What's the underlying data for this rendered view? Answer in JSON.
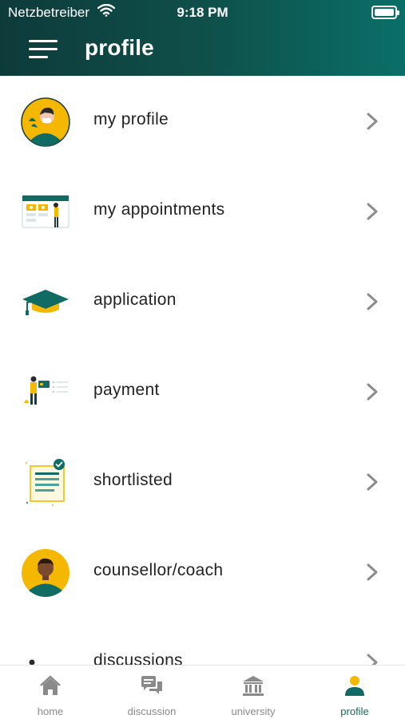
{
  "status_bar": {
    "carrier": "Netzbetreiber",
    "time": "9:18 PM"
  },
  "header": {
    "title": "profile",
    "menu_icon": "hamburger-menu-icon"
  },
  "menu_items": [
    {
      "label": "my profile",
      "icon": "user-avatar-icon"
    },
    {
      "label": "my appointments",
      "icon": "calendar-icon"
    },
    {
      "label": "application",
      "icon": "graduation-cap-icon"
    },
    {
      "label": "payment",
      "icon": "payment-card-icon"
    },
    {
      "label": "shortlisted",
      "icon": "checklist-document-icon"
    },
    {
      "label": "counsellor/coach",
      "icon": "counsellor-avatar-icon"
    },
    {
      "label": "discussions",
      "icon": "discussion-board-icon"
    }
  ],
  "tab_bar": {
    "tabs": [
      {
        "label": "home",
        "icon": "home-icon"
      },
      {
        "label": "discussion",
        "icon": "chat-icon"
      },
      {
        "label": "university",
        "icon": "university-icon"
      },
      {
        "label": "profile",
        "icon": "user-icon",
        "active": true
      }
    ]
  },
  "colors": {
    "header_dark": "#0d3b3a",
    "header_light": "#0a6f68",
    "accent": "#0f6b63",
    "yellow": "#f5b800"
  }
}
